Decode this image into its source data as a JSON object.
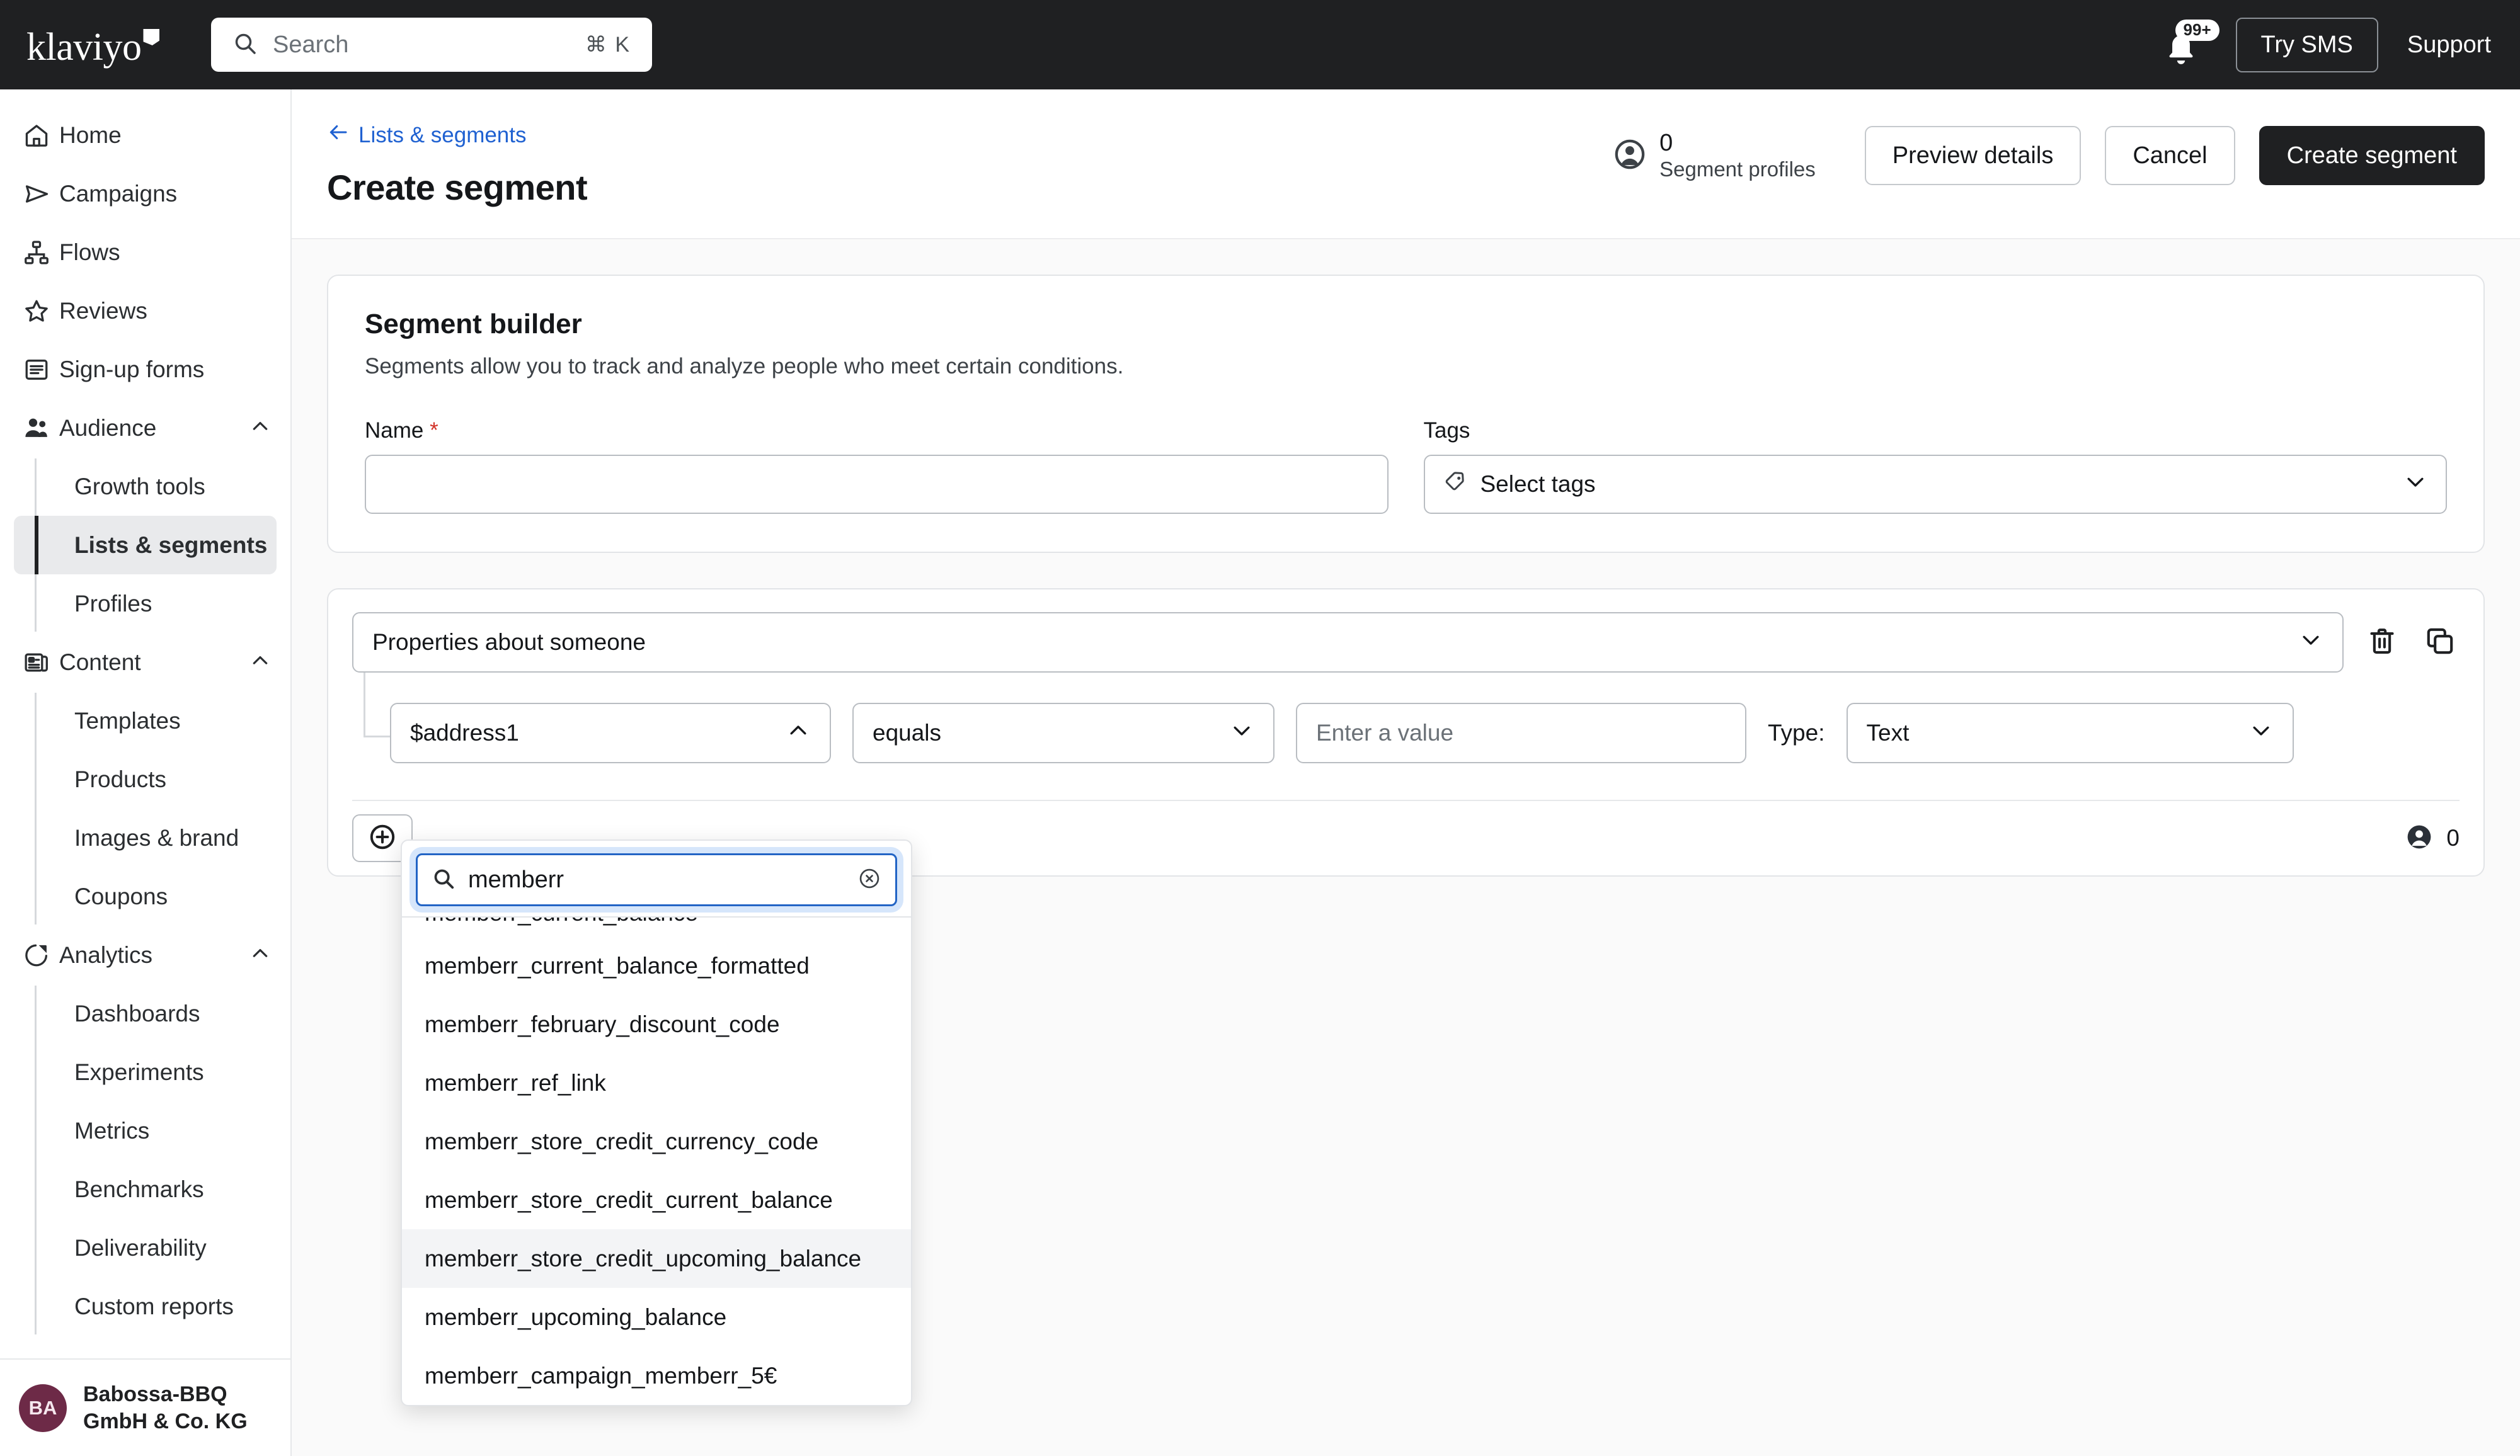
{
  "topbar": {
    "logo": "klaviyo",
    "search": {
      "placeholder": "Search",
      "shortcut": "⌘ K",
      "icon": "search-icon"
    },
    "notifications": {
      "badge": "99+",
      "icon": "bell-icon"
    },
    "try_sms": "Try SMS",
    "support": "Support"
  },
  "sidebar": {
    "items": [
      {
        "label": "Home",
        "icon": "home-icon"
      },
      {
        "label": "Campaigns",
        "icon": "send-icon"
      },
      {
        "label": "Flows",
        "icon": "flows-icon"
      },
      {
        "label": "Reviews",
        "icon": "star-icon"
      },
      {
        "label": "Sign-up forms",
        "icon": "form-icon"
      }
    ],
    "groups": [
      {
        "label": "Audience",
        "icon": "people-icon",
        "expanded": true,
        "children": [
          "Growth tools",
          "Lists & segments",
          "Profiles"
        ],
        "active_child": "Lists & segments"
      },
      {
        "label": "Content",
        "icon": "content-icon",
        "expanded": true,
        "children": [
          "Templates",
          "Products",
          "Images & brand",
          "Coupons"
        ]
      },
      {
        "label": "Analytics",
        "icon": "pie-icon",
        "expanded": true,
        "children": [
          "Dashboards",
          "Experiments",
          "Metrics",
          "Benchmarks",
          "Deliverability",
          "Custom reports"
        ]
      }
    ],
    "account": {
      "initials": "BA",
      "name_line1": "Babossa-BBQ",
      "name_line2": "GmbH & Co. KG"
    }
  },
  "page": {
    "breadcrumb": "Lists & segments",
    "title": "Create segment",
    "profiles": {
      "count": "0",
      "label": "Segment profiles",
      "icon": "person-icon"
    },
    "actions": {
      "preview": "Preview details",
      "cancel": "Cancel",
      "create": "Create segment"
    }
  },
  "builder": {
    "title": "Segment builder",
    "subtitle": "Segments allow you to track and analyze people who meet certain conditions.",
    "name": {
      "label": "Name",
      "required": "*",
      "value": "",
      "placeholder": ""
    },
    "tags": {
      "label": "Tags",
      "placeholder": "Select tags",
      "icon": "tag-icon"
    }
  },
  "condition": {
    "group_label": "Properties about someone",
    "delete_icon": "trash-icon",
    "duplicate_icon": "copy-icon",
    "property": "$address1",
    "operator": "equals",
    "value_placeholder": "Enter a value",
    "type_label": "Type:",
    "type_value": "Text",
    "add_icon": "plus-circle-icon",
    "footer_count": "0",
    "footer_icon": "person-icon"
  },
  "dropdown": {
    "search_value": "memberr",
    "search_icon": "search-icon",
    "clear_icon": "clear-circle-icon",
    "clipped_item": "memberr_current_balance",
    "items": [
      {
        "label": "memberr_current_balance_formatted",
        "highlighted": false
      },
      {
        "label": "memberr_february_discount_code",
        "highlighted": false
      },
      {
        "label": "memberr_ref_link",
        "highlighted": false
      },
      {
        "label": "memberr_store_credit_currency_code",
        "highlighted": false
      },
      {
        "label": "memberr_store_credit_current_balance",
        "highlighted": false
      },
      {
        "label": "memberr_store_credit_upcoming_balance",
        "highlighted": true
      },
      {
        "label": "memberr_upcoming_balance",
        "highlighted": false
      },
      {
        "label": "memberr_campaign_memberr_5€",
        "highlighted": false
      }
    ]
  },
  "colors": {
    "topbar_bg": "#1f2022",
    "link": "#1f61d1",
    "accent_dark": "#1f2022",
    "avatar_bg": "#6d2a47",
    "focus_blue": "#2264c5",
    "required_red": "#d2342a"
  }
}
